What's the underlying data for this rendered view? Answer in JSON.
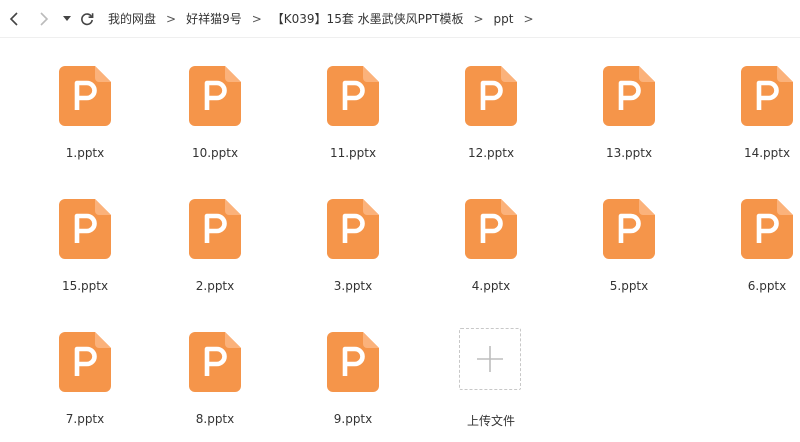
{
  "breadcrumbs": [
    {
      "label": "我的网盘"
    },
    {
      "label": "好祥猫9号"
    },
    {
      "label": "【K039】15套 水墨武侠风PPT模板"
    },
    {
      "label": "ppt"
    }
  ],
  "breadcrumb_separator": ">",
  "files": [
    {
      "name": "1.pptx"
    },
    {
      "name": "10.pptx"
    },
    {
      "name": "11.pptx"
    },
    {
      "name": "12.pptx"
    },
    {
      "name": "13.pptx"
    },
    {
      "name": "14.pptx"
    },
    {
      "name": "15.pptx"
    },
    {
      "name": "2.pptx"
    },
    {
      "name": "3.pptx"
    },
    {
      "name": "4.pptx"
    },
    {
      "name": "5.pptx"
    },
    {
      "name": "6.pptx"
    },
    {
      "name": "7.pptx"
    },
    {
      "name": "8.pptx"
    },
    {
      "name": "9.pptx"
    }
  ],
  "upload": {
    "label": "上传文件",
    "icon": "plus-icon"
  },
  "icons": {
    "back": "chevron-left-icon",
    "forward": "chevron-right-icon",
    "dropdown": "caret-down-icon",
    "refresh": "refresh-icon",
    "file": "pptx-file-icon"
  },
  "colors": {
    "file_icon": "#f5954a",
    "file_icon_light": "#fbb27b"
  }
}
